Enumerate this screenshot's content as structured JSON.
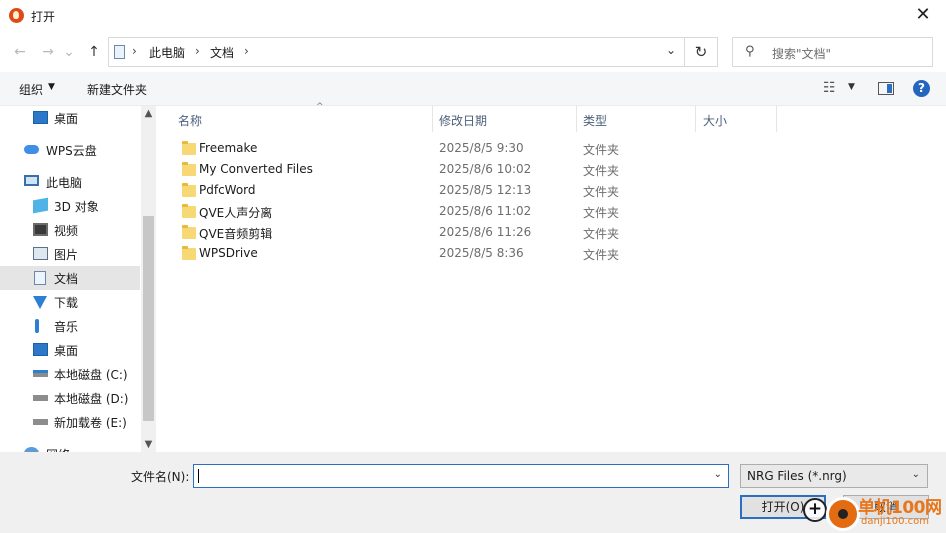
{
  "window": {
    "title": "打开",
    "close_glyph": "✕"
  },
  "navigation": {
    "back_glyph": "←",
    "forward_glyph": "→",
    "history_glyph": "⌄",
    "up_glyph": "↑",
    "breadcrumb": [
      "此电脑",
      "文档"
    ],
    "separator": "›",
    "dropdown_glyph": "⌄",
    "refresh_glyph": "↻",
    "search_placeholder": "搜索\"文档\"",
    "search_glyph": "⚲"
  },
  "toolbar": {
    "organize_label": "组织",
    "organize_arrow": "▼",
    "new_folder_label": "新建文件夹",
    "view_glyph": "☷",
    "view_arrow": "▼",
    "help_glyph": "?"
  },
  "sidebar": {
    "items": [
      {
        "label": "桌面",
        "icon": "desktop-icon",
        "indent": 1
      },
      {
        "label": "WPS云盘",
        "icon": "cloud-icon",
        "indent": 1
      },
      {
        "label": "此电脑",
        "icon": "computer-icon",
        "indent": 1
      },
      {
        "label": "3D 对象",
        "icon": "cube-icon",
        "indent": 2
      },
      {
        "label": "视频",
        "icon": "video-icon",
        "indent": 2
      },
      {
        "label": "图片",
        "icon": "picture-icon",
        "indent": 2
      },
      {
        "label": "文档",
        "icon": "document-icon",
        "indent": 2,
        "selected": true
      },
      {
        "label": "下载",
        "icon": "download-icon",
        "indent": 2
      },
      {
        "label": "音乐",
        "icon": "music-icon",
        "indent": 2
      },
      {
        "label": "桌面",
        "icon": "desktop-icon",
        "indent": 2
      },
      {
        "label": "本地磁盘 (C:)",
        "icon": "drive-c-icon",
        "indent": 2
      },
      {
        "label": "本地磁盘 (D:)",
        "icon": "drive-icon",
        "indent": 2
      },
      {
        "label": "新加载卷 (E:)",
        "icon": "drive-icon",
        "indent": 2
      },
      {
        "label": "网络",
        "icon": "network-icon",
        "indent": 1
      }
    ],
    "scroll_up_glyph": "▲",
    "scroll_down_glyph": "▼"
  },
  "filelist": {
    "columns": [
      "名称",
      "修改日期",
      "类型",
      "大小"
    ],
    "sort_glyph": "^",
    "rows": [
      {
        "name": "Freemake",
        "date": "2025/8/5 9:30",
        "type": "文件夹"
      },
      {
        "name": "My Converted Files",
        "date": "2025/8/6 10:02",
        "type": "文件夹"
      },
      {
        "name": "PdfcWord",
        "date": "2025/8/5 12:13",
        "type": "文件夹"
      },
      {
        "name": "QVE人声分离",
        "date": "2025/8/6 11:02",
        "type": "文件夹"
      },
      {
        "name": "QVE音频剪辑",
        "date": "2025/8/6 11:26",
        "type": "文件夹"
      },
      {
        "name": "WPSDrive",
        "date": "2025/8/5 8:36",
        "type": "文件夹"
      }
    ]
  },
  "footer": {
    "filename_label": "文件名(N):",
    "filename_value": "",
    "filter_value": "NRG Files (*.nrg)",
    "dropdown_glyph": "⌄",
    "open_label": "打开(O)",
    "cancel_label": "取消"
  },
  "overlay": {
    "cursor_glyph": "+",
    "watermark_text": "单机100网",
    "watermark_url": "danji100.com"
  },
  "colors": {
    "accent": "#2a6fc1",
    "selected_bg": "#e5e5e5",
    "folder": "#f8d775",
    "watermark": "#e8761b"
  }
}
